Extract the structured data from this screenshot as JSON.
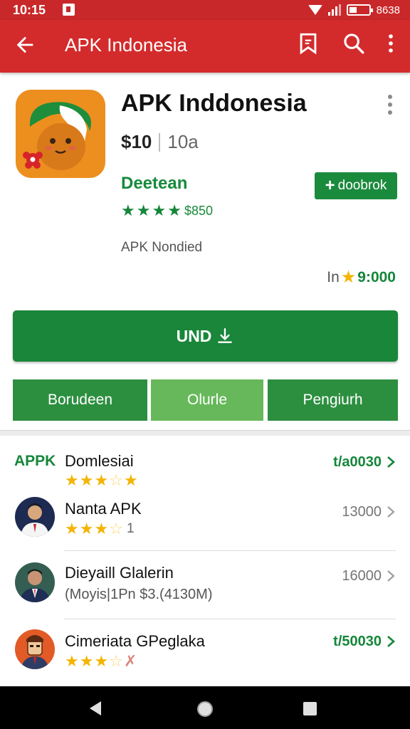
{
  "status_bar": {
    "time": "10:15",
    "battery_text": "8638",
    "icons": [
      "notification-icon",
      "wifi-icon",
      "signal-icon",
      "battery-icon"
    ]
  },
  "app_bar": {
    "title": "APK Indonesia",
    "icons": [
      "back-arrow-icon",
      "bookmark-icon",
      "search-icon",
      "overflow-menu-icon"
    ],
    "color": "#d32b2c"
  },
  "app": {
    "title": "APK Inddonesia",
    "price": "$10",
    "size": "10a",
    "developer": "Deetean",
    "follow_label": "doobrok",
    "rating_count": "$850",
    "subtitle": "APK Nondied",
    "install_prefix": "In",
    "install_count": "9:000",
    "install_label": "UND"
  },
  "segments": [
    {
      "label": "Borudeen",
      "color": "#2c8f3f"
    },
    {
      "label": "Olurle",
      "color": "#67b85a"
    },
    {
      "label": "Pengiurh",
      "color": "#2c8f3f"
    }
  ],
  "list": [
    {
      "prefix": "APPK",
      "title": "Domlesiai",
      "value": "t/a0030",
      "stars": [
        1,
        1,
        1,
        0.5,
        0.5
      ],
      "stars_tail": "",
      "subtitle": "",
      "value_green": true
    },
    {
      "title": "Nanta APK",
      "value": "13000",
      "stars": [
        1,
        1,
        1,
        0.5
      ],
      "stars_tail": "1",
      "subtitle": "",
      "value_green": false
    },
    {
      "title": "Dieyaill Glalerin",
      "value": "16000",
      "stars": [],
      "stars_tail": "",
      "subtitle": "(Moyis|1Pn $3.(4130M)",
      "value_green": false
    },
    {
      "title": "Cimeriata GPeglaka",
      "value": "t/50030",
      "stars": [
        1,
        1,
        1,
        0.5,
        0
      ],
      "stars_tail": "",
      "subtitle": "",
      "value_green": true
    }
  ],
  "accent": {
    "green": "#198639",
    "light_green": "#67b85a",
    "star": "#f4b400",
    "red": "#c9282a"
  }
}
